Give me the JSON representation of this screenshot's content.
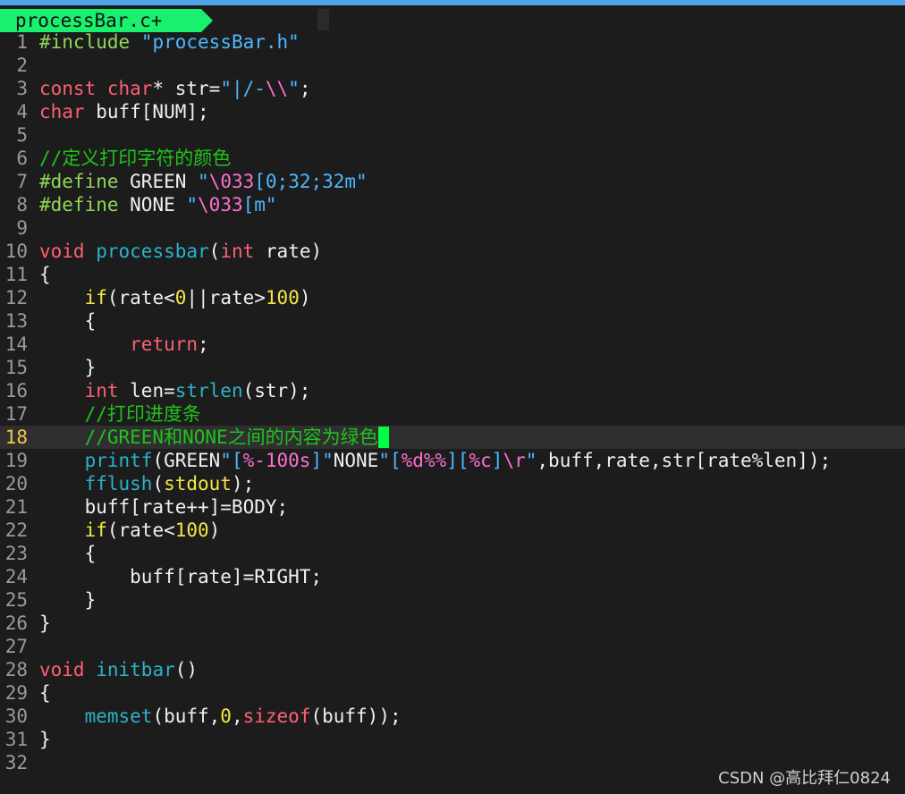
{
  "tab": {
    "filename": "processBar.c+"
  },
  "colors": {
    "background": "#1c1c1c",
    "tab": "#19f06e",
    "keyword": "#ff5f73",
    "type": "#ff5f73",
    "function": "#2ab3c8",
    "string": "#4db8ff",
    "escape": "#ff6fd1",
    "number": "#f5e642",
    "comment": "#21c21d",
    "preproc": "#8fd65a",
    "current_line_number": "#f2c94c",
    "cursor": "#00ff44"
  },
  "editor": {
    "current_line": 18,
    "lines": [
      {
        "n": "1",
        "t": [
          [
            "#include",
            "p"
          ],
          [
            " ",
            ""
          ],
          [
            "\"processBar.h\"",
            "s"
          ]
        ]
      },
      {
        "n": "2",
        "t": []
      },
      {
        "n": "3",
        "t": [
          [
            "const",
            "k"
          ],
          [
            " ",
            ""
          ],
          [
            "char",
            "k"
          ],
          [
            "* str=",
            ""
          ],
          [
            "\"|/-",
            "s"
          ],
          [
            "\\\\",
            "e"
          ],
          [
            "\"",
            "s"
          ],
          [
            ";",
            ""
          ]
        ]
      },
      {
        "n": "4",
        "t": [
          [
            "char",
            "k"
          ],
          [
            " buff[NUM];",
            ""
          ]
        ]
      },
      {
        "n": "5",
        "t": []
      },
      {
        "n": "6",
        "t": [
          [
            "//定义打印字符的颜色",
            "c"
          ]
        ]
      },
      {
        "n": "7",
        "t": [
          [
            "#define",
            "p"
          ],
          [
            " GREEN ",
            ""
          ],
          [
            "\"",
            "s"
          ],
          [
            "\\033",
            "e"
          ],
          [
            "[0;32;32m\"",
            "s"
          ]
        ]
      },
      {
        "n": "8",
        "t": [
          [
            "#define",
            "p"
          ],
          [
            " NONE ",
            ""
          ],
          [
            "\"",
            "s"
          ],
          [
            "\\033",
            "e"
          ],
          [
            "[m\"",
            "s"
          ]
        ]
      },
      {
        "n": "9",
        "t": []
      },
      {
        "n": "10",
        "t": [
          [
            "void",
            "k"
          ],
          [
            " ",
            ""
          ],
          [
            "processbar",
            "f"
          ],
          [
            "(",
            ""
          ],
          [
            "int",
            "k"
          ],
          [
            " rate)",
            ""
          ]
        ]
      },
      {
        "n": "11",
        "t": [
          [
            "{",
            ""
          ]
        ]
      },
      {
        "n": "12",
        "t": [
          [
            "    ",
            ""
          ],
          [
            "if",
            "y"
          ],
          [
            "(rate<",
            ""
          ],
          [
            "0",
            "y"
          ],
          [
            "||rate>",
            ""
          ],
          [
            "100",
            "y"
          ],
          [
            ")",
            ""
          ]
        ]
      },
      {
        "n": "13",
        "t": [
          [
            "    {",
            ""
          ]
        ]
      },
      {
        "n": "14",
        "t": [
          [
            "        ",
            ""
          ],
          [
            "return",
            "k"
          ],
          [
            ";",
            ""
          ]
        ]
      },
      {
        "n": "15",
        "t": [
          [
            "    }",
            ""
          ]
        ]
      },
      {
        "n": "16",
        "t": [
          [
            "    ",
            ""
          ],
          [
            "int",
            "k"
          ],
          [
            " len=",
            ""
          ],
          [
            "strlen",
            "f"
          ],
          [
            "(str);",
            ""
          ]
        ]
      },
      {
        "n": "17",
        "t": [
          [
            "    ",
            ""
          ],
          [
            "//打印进度条",
            "c"
          ]
        ]
      },
      {
        "n": "18",
        "t": [
          [
            "    ",
            ""
          ],
          [
            "//GREEN和NONE之间的内容为绿色",
            "c"
          ]
        ],
        "cursor": true
      },
      {
        "n": "19",
        "t": [
          [
            "    ",
            ""
          ],
          [
            "printf",
            "f"
          ],
          [
            "(GREEN",
            ""
          ],
          [
            "\"[",
            "s"
          ],
          [
            "%-100s",
            "e"
          ],
          [
            "]\"",
            "s"
          ],
          [
            "NONE",
            ""
          ],
          [
            "\"[",
            "s"
          ],
          [
            "%d%%",
            "e"
          ],
          [
            "][",
            "s"
          ],
          [
            "%c",
            "e"
          ],
          [
            "]",
            "s"
          ],
          [
            "\\r",
            "e"
          ],
          [
            "\"",
            "s"
          ],
          [
            ",buff,rate,str[rate%len]);",
            ""
          ]
        ]
      },
      {
        "n": "20",
        "t": [
          [
            "    ",
            ""
          ],
          [
            "fflush",
            "f"
          ],
          [
            "(",
            ""
          ],
          [
            "stdout",
            "y"
          ],
          [
            ");",
            ""
          ]
        ]
      },
      {
        "n": "21",
        "t": [
          [
            "    buff[rate++]=BODY;",
            ""
          ]
        ]
      },
      {
        "n": "22",
        "t": [
          [
            "    ",
            ""
          ],
          [
            "if",
            "y"
          ],
          [
            "(rate<",
            ""
          ],
          [
            "100",
            "y"
          ],
          [
            ")",
            ""
          ]
        ]
      },
      {
        "n": "23",
        "t": [
          [
            "    {",
            ""
          ]
        ]
      },
      {
        "n": "24",
        "t": [
          [
            "        buff[rate]=RIGHT;",
            ""
          ]
        ]
      },
      {
        "n": "25",
        "t": [
          [
            "    }",
            ""
          ]
        ]
      },
      {
        "n": "26",
        "t": [
          [
            "}",
            ""
          ]
        ]
      },
      {
        "n": "27",
        "t": []
      },
      {
        "n": "28",
        "t": [
          [
            "void",
            "k"
          ],
          [
            " ",
            ""
          ],
          [
            "initbar",
            "f"
          ],
          [
            "()",
            ""
          ]
        ]
      },
      {
        "n": "29",
        "t": [
          [
            "{",
            ""
          ]
        ]
      },
      {
        "n": "30",
        "t": [
          [
            "    ",
            ""
          ],
          [
            "memset",
            "f"
          ],
          [
            "(buff,",
            ""
          ],
          [
            "0",
            "y"
          ],
          [
            ",",
            ""
          ],
          [
            "sizeof",
            "k"
          ],
          [
            "(buff));",
            ""
          ]
        ]
      },
      {
        "n": "31",
        "t": [
          [
            "}",
            ""
          ]
        ]
      },
      {
        "n": "32",
        "t": []
      }
    ]
  },
  "watermark": "CSDN @高比拜仁0824"
}
